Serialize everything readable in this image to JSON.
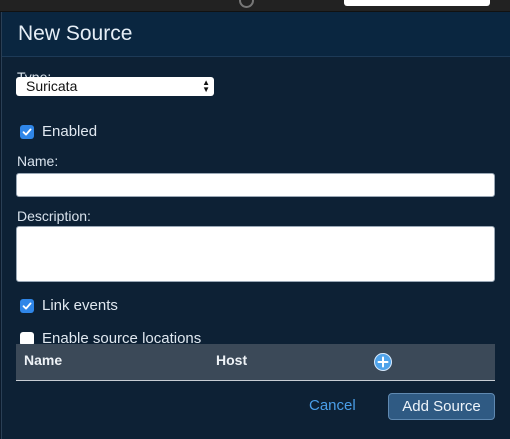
{
  "dialog": {
    "title": "New Source",
    "type_label": "Type:",
    "type_value": "Suricata",
    "enabled_label": "Enabled",
    "enabled_checked": true,
    "name_label": "Name:",
    "name_value": "",
    "description_label": "Description:",
    "description_value": "",
    "link_events_label": "Link events",
    "link_events_checked": true,
    "enable_locations_label": "Enable source locations",
    "enable_locations_checked": false,
    "locations_table": {
      "columns": [
        "Name",
        "Host"
      ]
    },
    "cancel_label": "Cancel",
    "submit_label": "Add Source"
  },
  "colors": {
    "dialog_bg": "#0d2135",
    "header_bg": "#0a2640",
    "accent": "#2f86e8",
    "link": "#4a9ee8",
    "primary_button": "#2f5a83"
  },
  "icons": {
    "checkbox_checked": "check-icon",
    "add_row": "plus-circle-icon",
    "select_arrows": "select-arrows-icon"
  }
}
